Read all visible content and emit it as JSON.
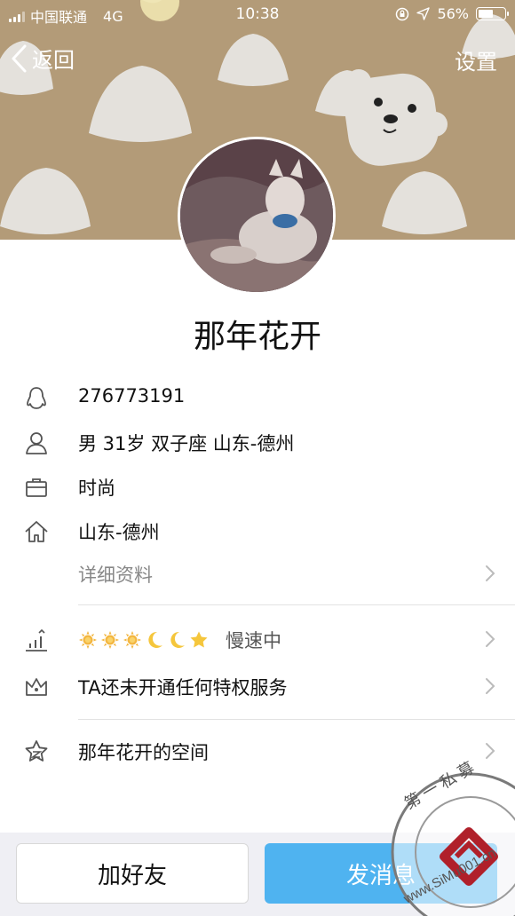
{
  "status_bar": {
    "carrier": "中国联通",
    "network": "4G",
    "time": "10:38",
    "battery": "56%"
  },
  "nav": {
    "back_label": "返回",
    "settings_label": "设置"
  },
  "profile": {
    "nickname": "那年花开",
    "qq_number": "276773191",
    "basic_info": "男  31岁  双子座  山东-德州",
    "occupation": "时尚",
    "hometown": "山东-德州",
    "detail_link": "详细资料"
  },
  "level": {
    "icons": [
      "sun",
      "sun",
      "sun",
      "moon",
      "moon",
      "star"
    ],
    "speed_label": "慢速中"
  },
  "privilege": {
    "label": "TA还未开通任何特权服务"
  },
  "space": {
    "label": "那年花开的空间"
  },
  "actions": {
    "add_friend": "加好友",
    "send_message": "发消息"
  },
  "watermark": {
    "top_text": "第一私募",
    "bottom_text": "www.SiMu001.cn"
  },
  "colors": {
    "cover": "#b39b78",
    "accent": "#4fb3f0",
    "divider": "#e2e2e2"
  }
}
